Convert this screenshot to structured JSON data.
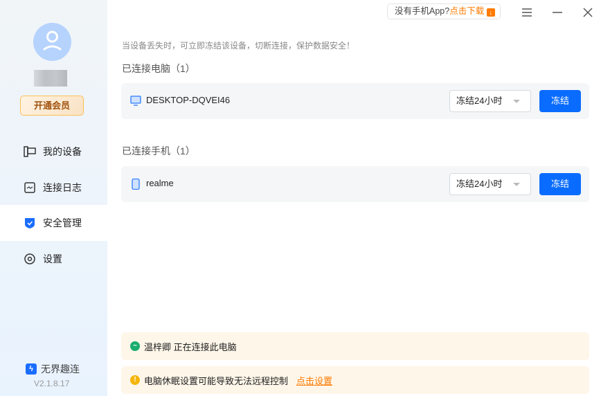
{
  "sidebar": {
    "vip_label": "开通会员",
    "items": [
      {
        "label": "我的设备"
      },
      {
        "label": "连接日志"
      },
      {
        "label": "安全管理"
      },
      {
        "label": "设置"
      }
    ],
    "brand": "无界趣连",
    "version": "V2.1.8.17"
  },
  "header": {
    "promo_text": "没有手机App?",
    "promo_link": "点击下载"
  },
  "main": {
    "tip": "当设备丢失时，可立即冻结该设备，切断连接，保护数据安全！",
    "pc_section": "已连接电脑（1）",
    "pc": {
      "name": "DESKTOP-DQVEI46",
      "duration": "冻结24小时",
      "button": "冻结"
    },
    "phone_section": "已连接手机（1）",
    "phone": {
      "name": "realme",
      "duration": "冻结24小时",
      "button": "冻结"
    }
  },
  "notices": {
    "connecting": "温梓卿 正在连接此电脑",
    "sleep_warning": "电脑休眠设置可能导致无法远程控制",
    "sleep_link": "点击设置"
  },
  "colors": {
    "accent": "#0a6cff",
    "orange": "#ff7a00",
    "green": "#1aad6e"
  }
}
